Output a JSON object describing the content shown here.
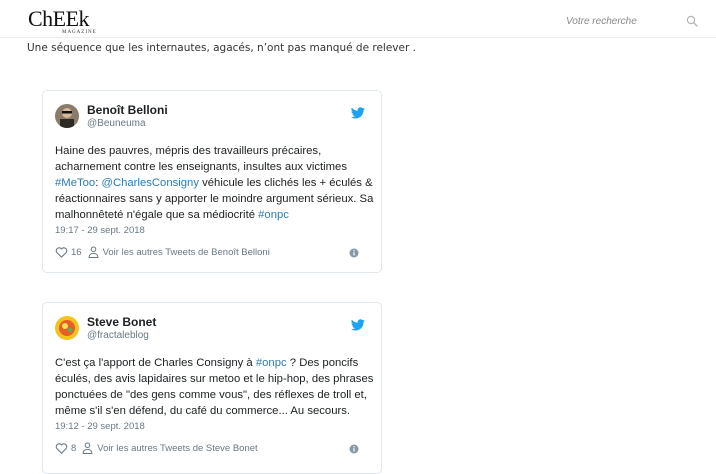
{
  "header": {
    "logo": "ChEEk",
    "logo_sub": "MAGAZINE",
    "search_placeholder": "Votre recherche"
  },
  "article": {
    "intro": "Une séquence que les internautes, agacés, n’ont pas manqué de relever ."
  },
  "tweets": [
    {
      "author": "Benoît Belloni",
      "handle": "@Beuneuma",
      "text_parts": [
        "Haine des pauvres, mépris des travailleurs précaires, acharnement contre les enseignants, insultes aux victimes ",
        "#MeToo",
        ": ",
        "@CharlesConsigny",
        " véhicule les clichés les + éculés & réactionnaires sans y apporter le moindre argument sérieux. Sa malhonnêteté n'égale que sa médiocrité ",
        "#onpc"
      ],
      "timestamp": "19:17 - 29 sept. 2018",
      "likes": "16",
      "more_link": "Voir les autres Tweets de Benoît Belloni"
    },
    {
      "author": "Steve Bonet",
      "handle": "@fractaleblog",
      "text_parts": [
        "C'est ça l'apport de Charles Consigny à ",
        "#onpc",
        " ? Des poncifs éculés, des avis lapidaires sur metoo et le hip-hop, des phrases ponctuées de \"des gens comme vous\", des réflexes de troll et, même s'il s'en défend, du café du commerce... Au secours."
      ],
      "timestamp": "19:12 - 29 sept. 2018",
      "likes": "8",
      "more_link": "Voir les autres Tweets de Steve Bonet"
    }
  ],
  "colors": {
    "link": "#2b7bb9",
    "twitter_blue": "#1da1f2",
    "muted": "#697882",
    "border": "#e1e8ed"
  },
  "icons": [
    "search-icon",
    "twitter-bird-icon",
    "heart-icon",
    "person-icon",
    "info-icon"
  ]
}
